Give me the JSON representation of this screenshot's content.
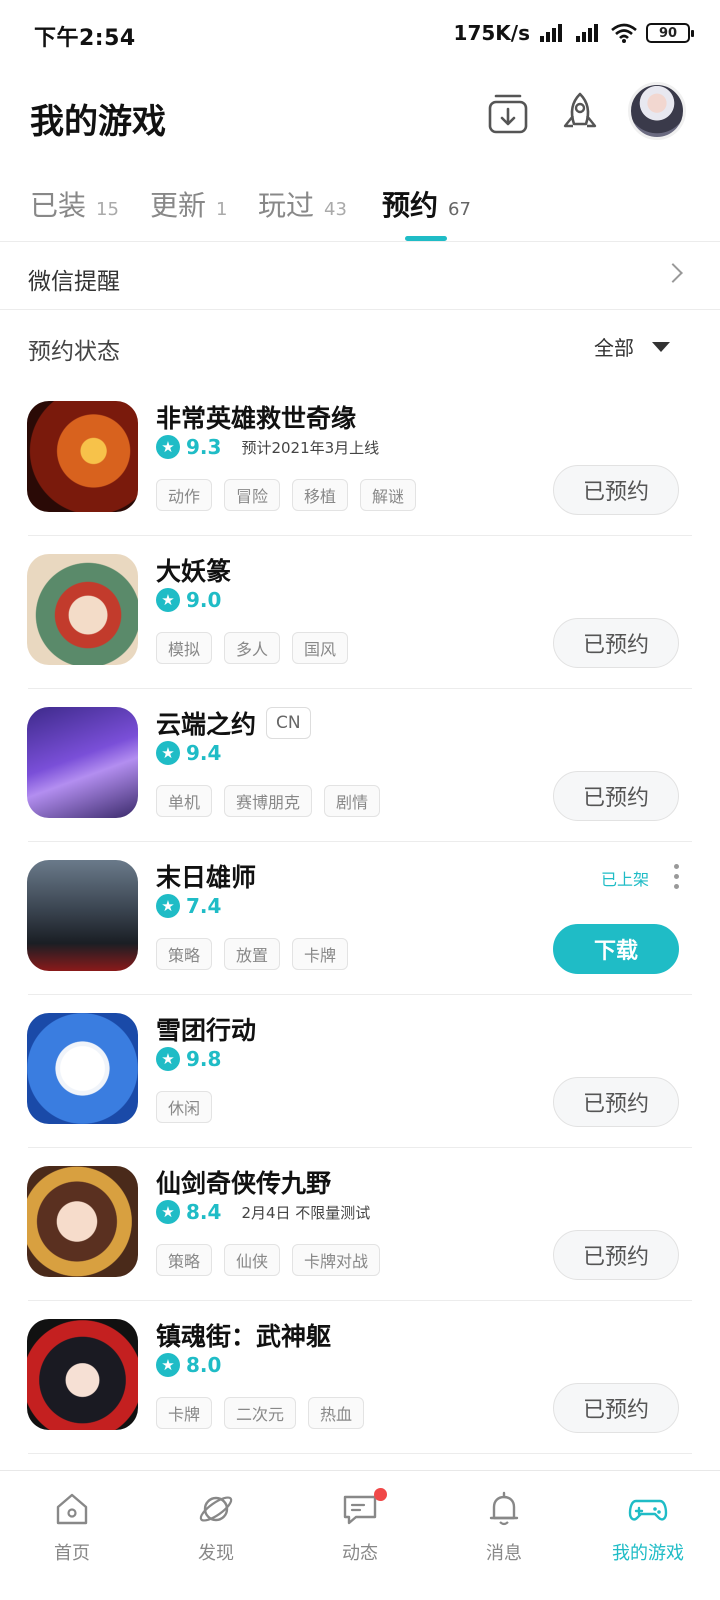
{
  "status_bar": {
    "time": "下午2:54",
    "net_speed": "175K/s",
    "battery": "90"
  },
  "header": {
    "title": "我的游戏",
    "download_icon": "download-box-icon",
    "rocket_icon": "rocket-icon"
  },
  "tabs": [
    {
      "label": "已装",
      "count": "15",
      "active": false
    },
    {
      "label": "更新",
      "count": "1",
      "active": false
    },
    {
      "label": "玩过",
      "count": "43",
      "active": false
    },
    {
      "label": "预约",
      "count": "67",
      "active": true
    }
  ],
  "wechat": {
    "label": "微信提醒"
  },
  "filter": {
    "label": "预约状态",
    "value": "全部"
  },
  "games": [
    {
      "name": "非常英雄救世奇缘",
      "score": "9.3",
      "note": "预计2021年3月上线",
      "tags": [
        "动作",
        "冒险",
        "移植",
        "解谜"
      ],
      "action": "已预约"
    },
    {
      "name": "大妖篆",
      "score": "9.0",
      "tags": [
        "模拟",
        "多人",
        "国风"
      ],
      "action": "已预约"
    },
    {
      "name": "云端之约",
      "badge": "CN",
      "score": "9.4",
      "tags": [
        "单机",
        "赛博朋克",
        "剧情"
      ],
      "action": "已预约"
    },
    {
      "name": "末日雄师",
      "score": "7.4",
      "tags": [
        "策略",
        "放置",
        "卡牌"
      ],
      "action": "下载",
      "status": "已上架"
    },
    {
      "name": "雪团行动",
      "score": "9.8",
      "tags": [
        "休闲"
      ],
      "action": "已预约"
    },
    {
      "name": "仙剑奇侠传九野",
      "score": "8.4",
      "note": "2月4日 不限量测试",
      "tags": [
        "策略",
        "仙侠",
        "卡牌对战"
      ],
      "action": "已预约"
    },
    {
      "name": "镇魂街：武神躯",
      "score": "8.0",
      "tags": [
        "卡牌",
        "二次元",
        "热血"
      ],
      "action": "已预约"
    }
  ],
  "nav": [
    {
      "label": "首页",
      "icon": "home-icon",
      "active": false
    },
    {
      "label": "发现",
      "icon": "planet-icon",
      "active": false
    },
    {
      "label": "动态",
      "icon": "chat-icon",
      "active": false,
      "dot": true
    },
    {
      "label": "消息",
      "icon": "bell-icon",
      "active": false
    },
    {
      "label": "我的游戏",
      "icon": "gamepad-icon",
      "active": true
    }
  ],
  "colors": {
    "accent": "#1fbcc6",
    "notification_dot": "#f04848"
  }
}
